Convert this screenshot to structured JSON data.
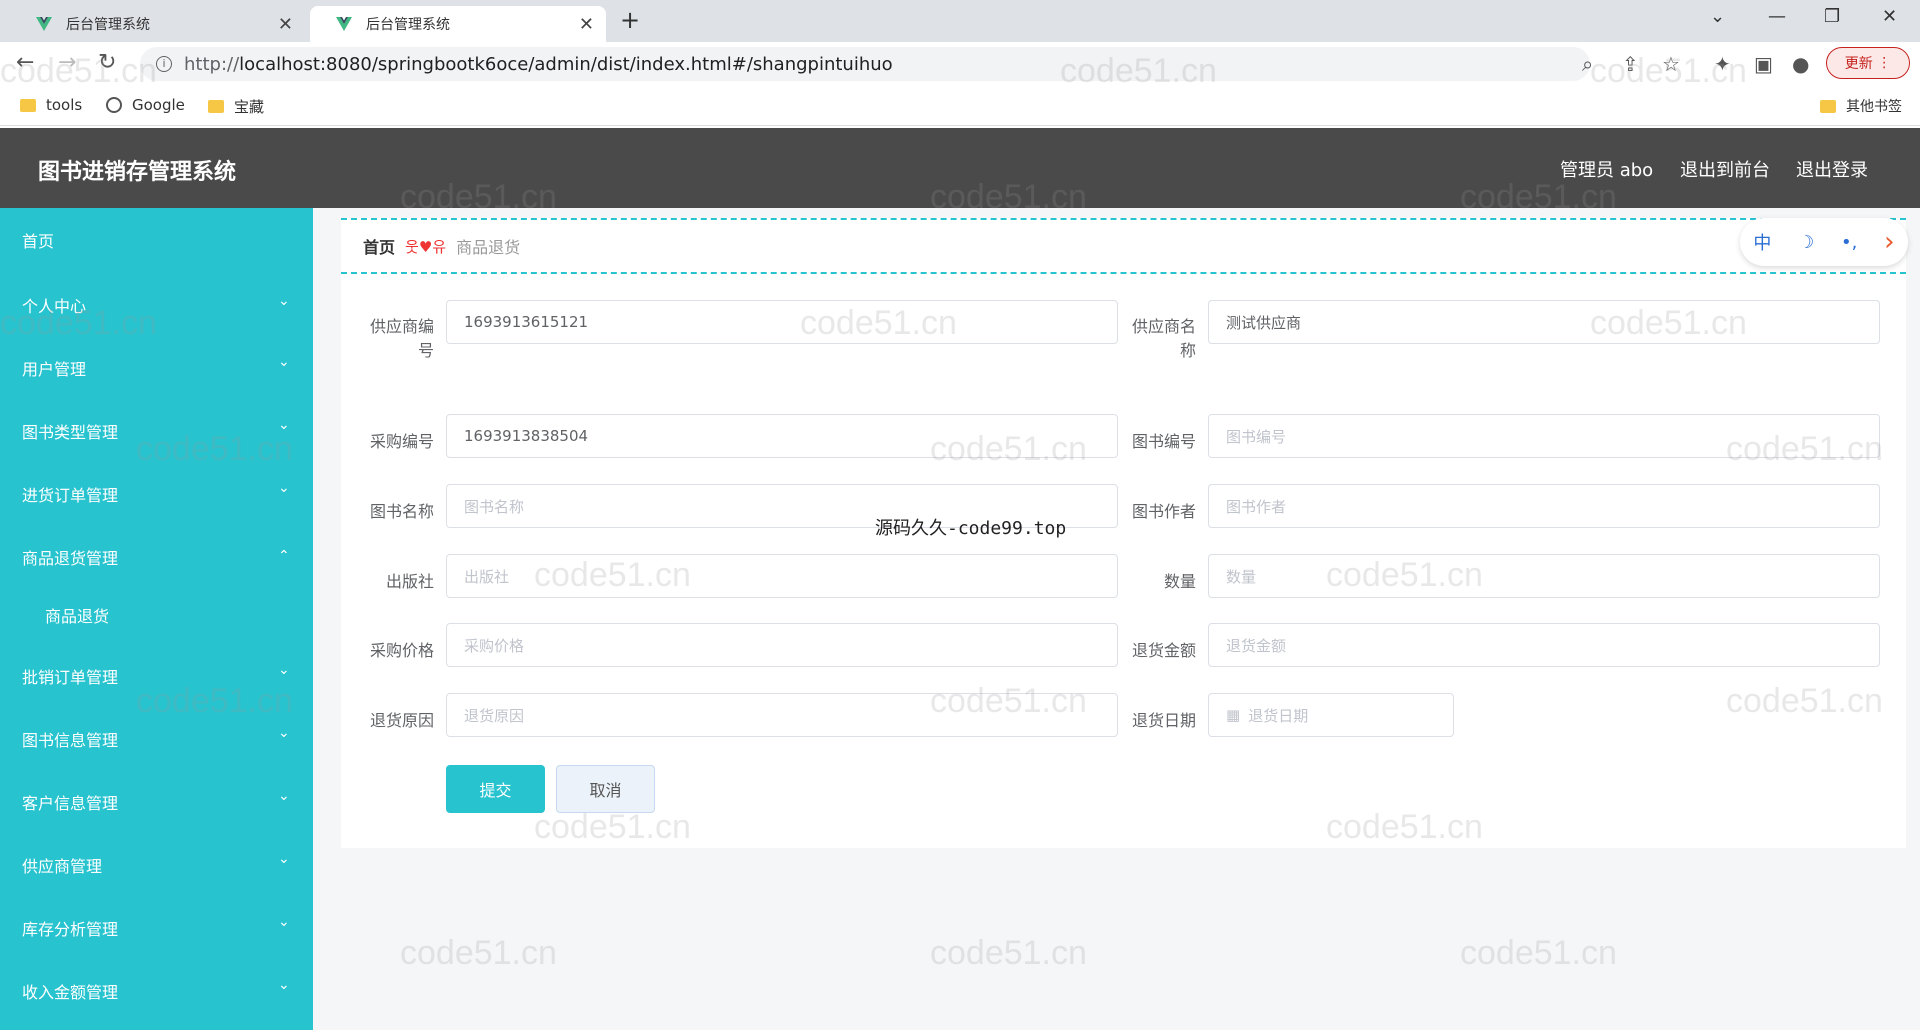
{
  "browser": {
    "tabs": [
      {
        "title": "后台管理系统",
        "active": false
      },
      {
        "title": "后台管理系统",
        "active": true
      }
    ],
    "url_prefix": "http://",
    "url_host": "localhost",
    "url_rest": ":8080/springbootk6oce/admin/dist/index.html#/shangpintuihuo",
    "update_label": "更新",
    "bookmarks": [
      "tools",
      "Google",
      "宝藏"
    ],
    "other_bookmarks": "其他书签"
  },
  "header": {
    "title": "图书进销存管理系统",
    "admin": "管理员 abo",
    "to_front": "退出到前台",
    "logout": "退出登录"
  },
  "sidebar": {
    "home": "首页",
    "items": [
      "个人中心",
      "用户管理",
      "图书类型管理",
      "进货订单管理",
      "商品退货管理",
      "批销订单管理",
      "图书信息管理",
      "客户信息管理",
      "供应商管理",
      "库存分析管理",
      "收入金额管理"
    ],
    "sub_item": "商品退货"
  },
  "breadcrumb": {
    "home": "首页",
    "current": "商品退货"
  },
  "float_tools": [
    "中",
    "☽",
    "•,",
    "›"
  ],
  "form": {
    "supplier_code_label": "供应商编号",
    "supplier_code_value": "1693913615121",
    "supplier_name_label": "供应商名称",
    "supplier_name_value": "测试供应商",
    "purchase_no_label": "采购编号",
    "purchase_no_value": "1693913838504",
    "book_no_label": "图书编号",
    "book_no_placeholder": "图书编号",
    "book_name_label": "图书名称",
    "book_name_placeholder": "图书名称",
    "author_label": "图书作者",
    "author_placeholder": "图书作者",
    "publisher_label": "出版社",
    "publisher_placeholder": "出版社",
    "qty_label": "数量",
    "qty_placeholder": "数量",
    "price_label": "采购价格",
    "price_placeholder": "采购价格",
    "refund_label": "退货金额",
    "refund_placeholder": "退货金额",
    "reason_label": "退货原因",
    "reason_placeholder": "退货原因",
    "date_label": "退货日期",
    "date_placeholder": "退货日期",
    "submit": "提交",
    "cancel": "取消"
  },
  "center_note": "源码久久-code99.top",
  "watermark": "code51.cn"
}
